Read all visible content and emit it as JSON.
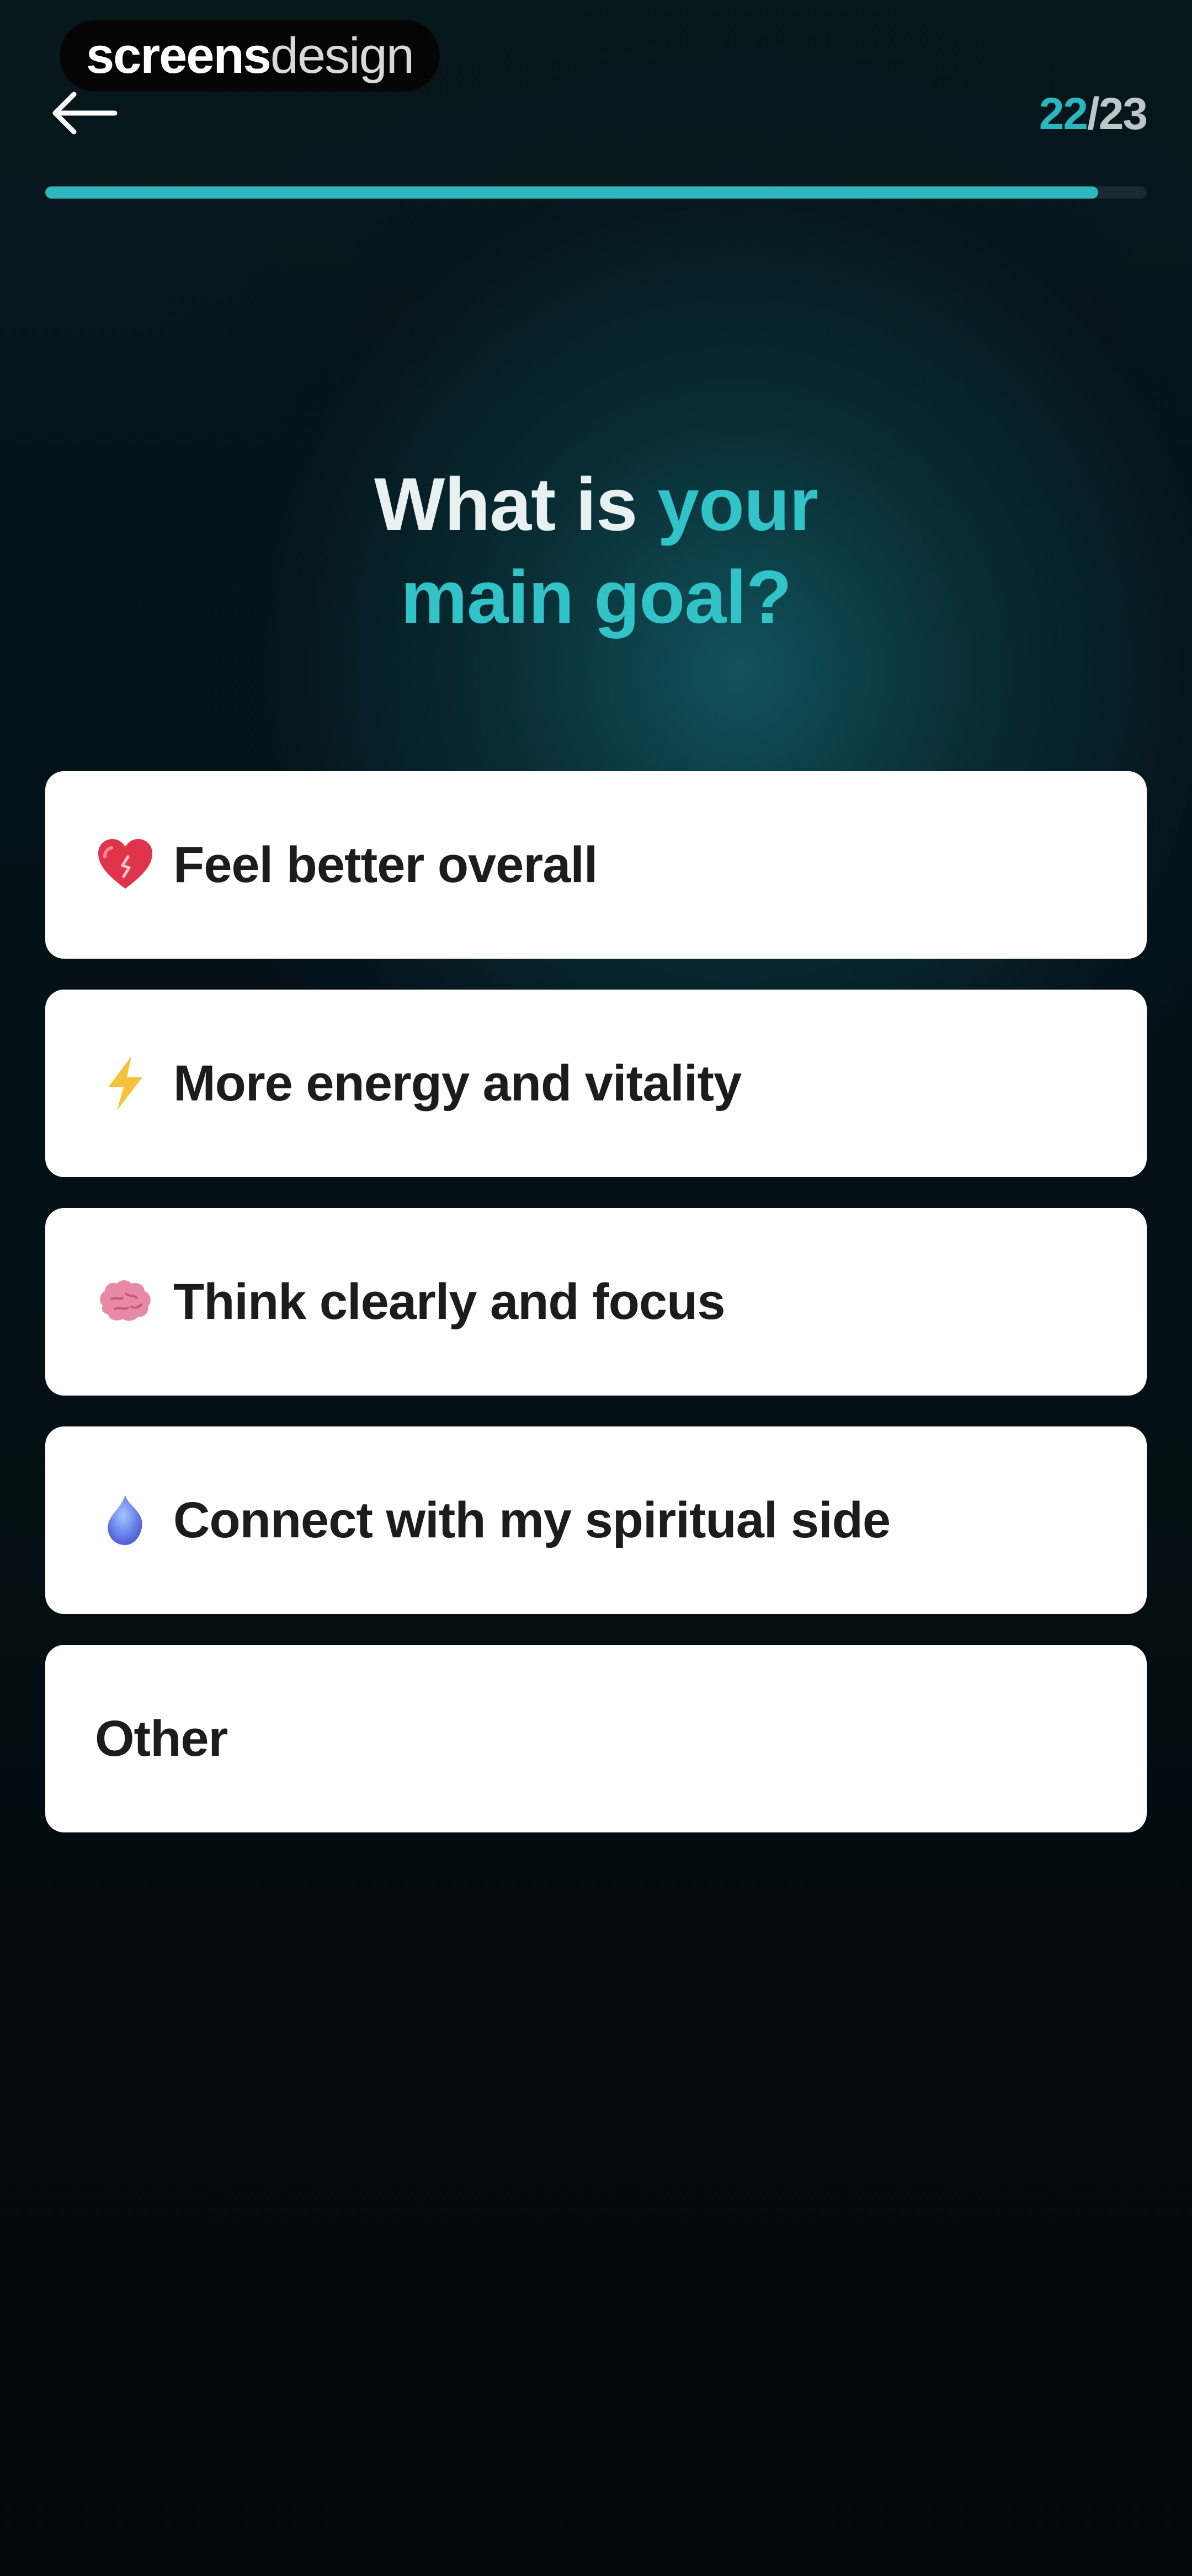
{
  "watermark": {
    "bold": "screens",
    "light": "design"
  },
  "header": {
    "back_icon": "arrow-left-icon",
    "step_current": "22",
    "step_separator": "/",
    "step_total": "23",
    "progress_fraction": 0.956
  },
  "question": {
    "line1_white": "What is ",
    "line1_accent": "your",
    "line2_accent": "main goal?"
  },
  "options": [
    {
      "icon": "heart-icon",
      "label": "Feel better overall"
    },
    {
      "icon": "lightning-icon",
      "label": "More energy and vitality"
    },
    {
      "icon": "brain-icon",
      "label": "Think clearly and focus"
    },
    {
      "icon": "spirit-orb-icon",
      "label": "Connect with my spiritual side"
    },
    {
      "icon": "",
      "label": "Other"
    }
  ],
  "colors": {
    "accent": "#2eb7bf",
    "card": "#ffffff",
    "background_dark": "#03090d"
  }
}
